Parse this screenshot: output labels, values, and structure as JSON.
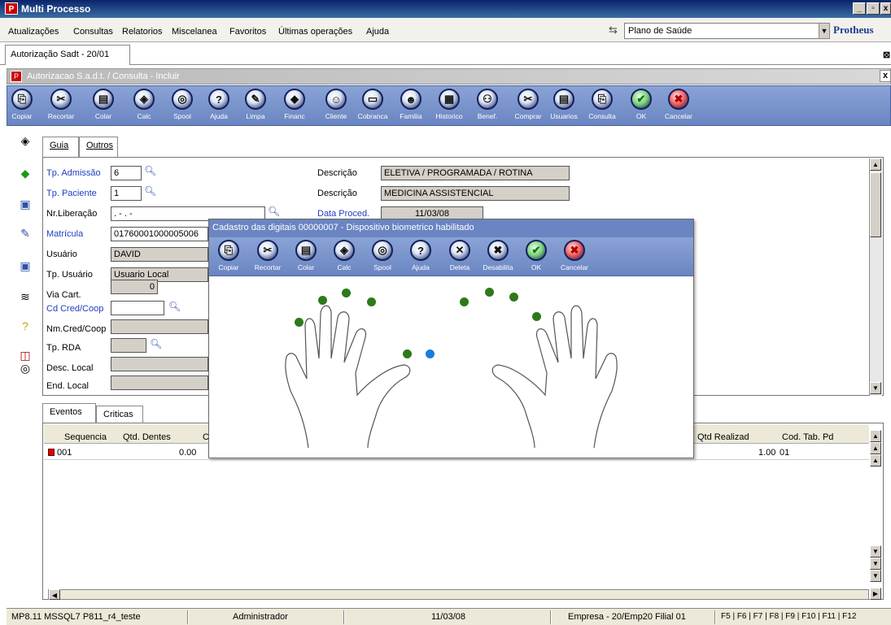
{
  "window": {
    "title": "Multi Processo"
  },
  "menu": [
    "Atualizações",
    "Consultas",
    "Relatorios",
    "Miscelanea",
    "Favoritos",
    "Últimas operações",
    "Ajuda"
  ],
  "module_select": {
    "value": "Plano de Saúde"
  },
  "brand": "Protheus",
  "doc_tab": "Autorização Sadt - 20/01",
  "subwindow_title": "Autorizacao S.a.d.t. / Consulta - Incluir",
  "toolbar": [
    "Copiar",
    "Recortar",
    "Colar",
    "Calc",
    "Spool",
    "Ajuda",
    "Limpa",
    "Financ",
    "Cliente",
    "Cobranca",
    "Familia",
    "Historico",
    "Benef.",
    "Comprar",
    "Usuarios",
    "Consulta",
    "OK",
    "Cancelar"
  ],
  "form_tabs": [
    "Guia",
    "Outros"
  ],
  "form": {
    "tp_admissao_label": "Tp. Admissão",
    "tp_admissao": "6",
    "descricao1_label": "Descrição",
    "descricao1": "ELETIVA / PROGRAMADA / ROTINA",
    "tp_paciente_label": "Tp. Paciente",
    "tp_paciente": "1",
    "descricao2_label": "Descrição",
    "descricao2": "MEDICINA ASSISTENCIAL",
    "nr_liberacao_label": "Nr.Liberação",
    "nr_liberacao": ".  -    .  -",
    "data_proced_label": "Data Proced.",
    "data_proced": "11/03/08",
    "matricula_label": "Matrícula",
    "matricula": "01760001000005006",
    "usuario_label": "Usuário",
    "usuario": "DAVID",
    "tp_usuario_label": "Tp. Usuário",
    "tp_usuario": "Usuario Local",
    "via_cart_label": "Via Cart.",
    "via_cart": "0",
    "cd_cred_label": "Cd Cred/Coop",
    "nm_cred_label": "Nm.Cred/Coop",
    "tp_rda_label": "Tp. RDA",
    "desc_local_label": "Desc. Local",
    "end_local_label": "End. Local"
  },
  "lower_tabs": [
    "Eventos",
    "Criticas"
  ],
  "grid": {
    "headers": [
      "Sequencia",
      "Qtd. Dentes",
      "C",
      "Qtd Realizad",
      "Cod. Tab. Pd"
    ],
    "row": {
      "sequencia": "001",
      "qtd_dentes": "0.00",
      "qtd_realizad": "1.00",
      "cod_tab": "01"
    }
  },
  "status": {
    "version": "MP8.11  MSSQL7 P811_r4_teste",
    "user": "Administrador",
    "date": "11/03/08",
    "company": "Empresa - 20/Emp20 Filial 01",
    "keys": "F5 | F6 | F7 | F8 | F9 | F10 | F11 | F12"
  },
  "dialog": {
    "title": "Cadastro das digitais 00000007 - Dispositivo biometrico habilitado",
    "toolbar": [
      "Copiar",
      "Recortar",
      "Colar",
      "Calc",
      "Spool",
      "Ajuda",
      "Deleta",
      "Desabilita",
      "OK",
      "Cancelar"
    ]
  },
  "colors": {
    "toolbar": "#6a85c2",
    "finger_dot": "#2d7a1a",
    "finger_dot_selected": "#1e7ad8"
  }
}
